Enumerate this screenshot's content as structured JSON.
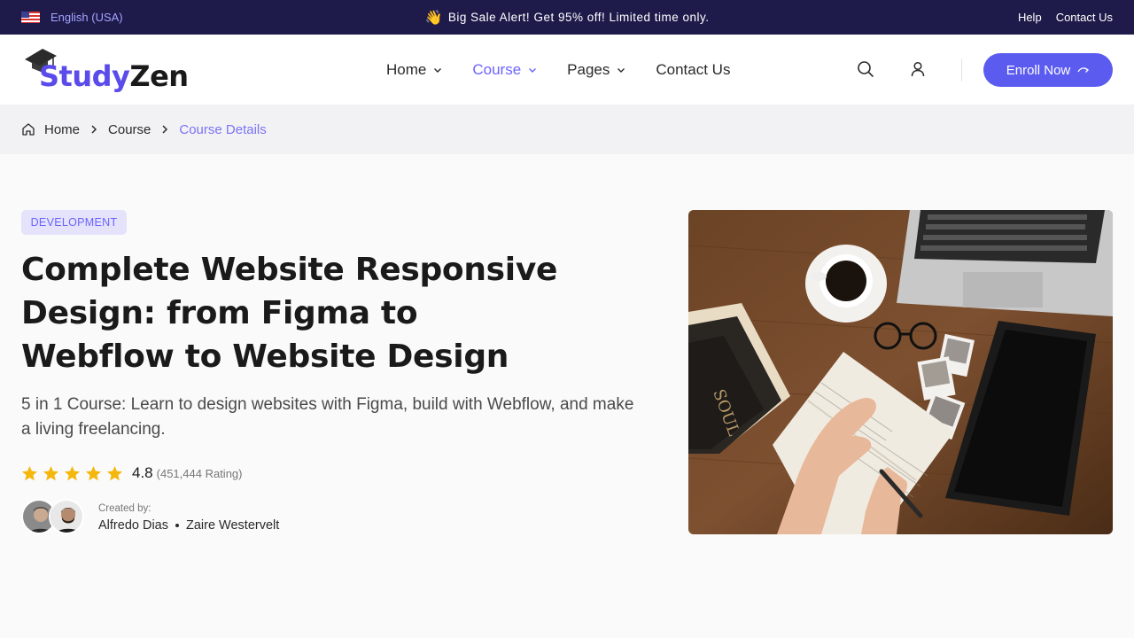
{
  "topbar": {
    "language": "English (USA)",
    "promo_emoji": "👋",
    "promo": "Big Sale Alert! Get 95% off! Limited time only.",
    "links": [
      "Help",
      "Contact Us"
    ]
  },
  "header": {
    "logo_part1": "Study",
    "logo_part2": "Zen",
    "nav": [
      {
        "label": "Home",
        "has_dropdown": true,
        "active": false
      },
      {
        "label": "Course",
        "has_dropdown": true,
        "active": true
      },
      {
        "label": "Pages",
        "has_dropdown": true,
        "active": false
      },
      {
        "label": "Contact Us",
        "has_dropdown": false,
        "active": false
      }
    ],
    "enroll_label": "Enroll Now",
    "icons": [
      "search-icon",
      "user-icon",
      "arrow-icon"
    ]
  },
  "breadcrumb": {
    "items": [
      "Home",
      "Course",
      "Course Details"
    ]
  },
  "course": {
    "category": "DEVELOPMENT",
    "title_lines": [
      "Complete Website Responsive",
      "Design: from Figma to",
      "Webflow to Website Design"
    ],
    "subtitle_lines": [
      "5 in 1 Course: Learn to design websites with Figma, build with Webflow, and make",
      "a living freelancing."
    ],
    "rating": "4.8",
    "rating_count": "(451,444 Rating)",
    "stars": 5,
    "created_by_label": "Created by:",
    "authors": [
      "Alfredo Dias",
      "Zaire Westervelt"
    ]
  },
  "colors": {
    "topbar_bg": "#1e1b4b",
    "accent": "#5b5bf0",
    "star": "#f5b70b",
    "badge_bg": "#e4e3fb"
  }
}
